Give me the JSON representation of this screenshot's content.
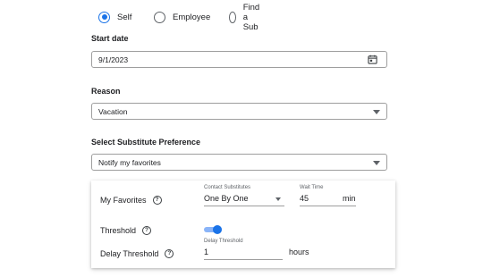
{
  "requester": {
    "options": [
      {
        "label": "Self",
        "selected": true
      },
      {
        "label": "Employee",
        "selected": false
      },
      {
        "label": "Find a Sub",
        "selected": false
      }
    ]
  },
  "start_date": {
    "label": "Start date",
    "value": "9/1/2023",
    "icon": "calendar-icon"
  },
  "reason": {
    "label": "Reason",
    "value": "Vacation"
  },
  "substitute_preference": {
    "label": "Select Substitute Preference",
    "value": "Notify my favorites"
  },
  "favorites_panel": {
    "my_favorites_label": "My Favorites",
    "contact_substitutes": {
      "label": "Contact Substitutes",
      "value": "One By One"
    },
    "wait_time": {
      "label": "Wait Time",
      "value": "45",
      "unit": "min"
    },
    "threshold_label": "Threshold",
    "threshold_enabled": true,
    "delay_threshold_label": "Delay Threshold",
    "delay_threshold": {
      "label": "Delay Threshold",
      "value": "1",
      "unit": "hours"
    }
  },
  "colors": {
    "accent": "#1a73e8",
    "toggle_track": "#8ab4f8",
    "border": "#9e9e9e"
  }
}
